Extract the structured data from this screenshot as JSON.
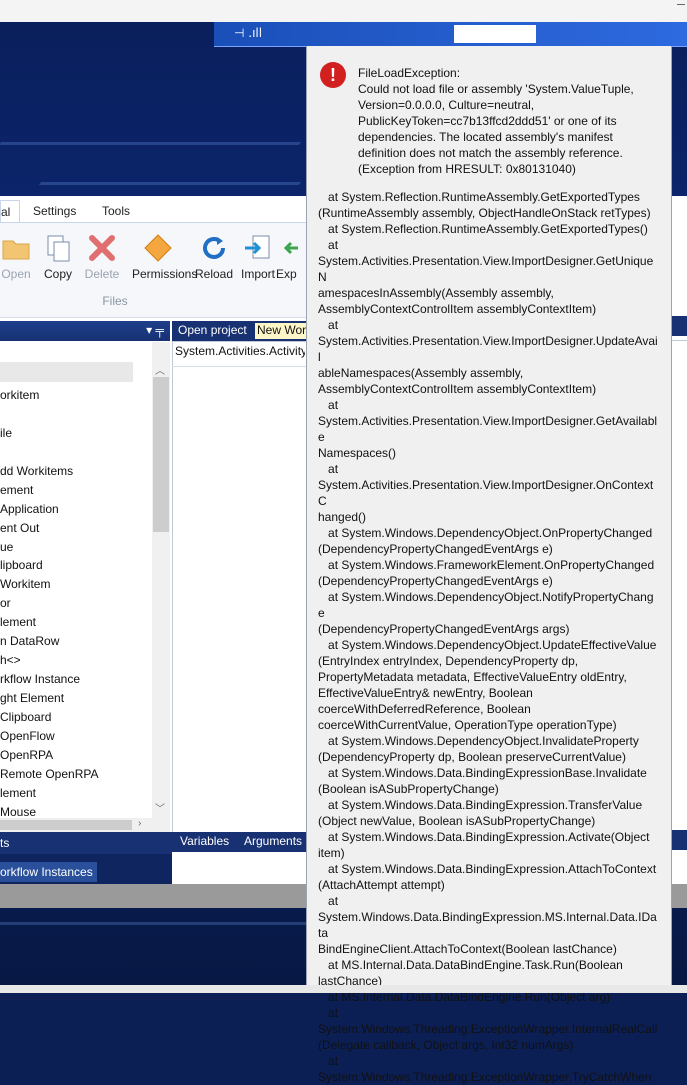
{
  "taskbar": {
    "tray_text": "⊣ .ıll"
  },
  "ribbon": {
    "tabs": [
      {
        "label": "al",
        "active": true
      },
      {
        "label": "Settings",
        "active": false
      },
      {
        "label": "Tools",
        "active": false
      }
    ],
    "buttons": [
      {
        "label": "Open",
        "icon": "folder-icon",
        "enabled": false
      },
      {
        "label": "Copy",
        "icon": "copy-icon",
        "enabled": true
      },
      {
        "label": "Delete",
        "icon": "delete-x-icon",
        "enabled": false
      },
      {
        "label": "Permissions",
        "icon": "key-icon",
        "enabled": true
      },
      {
        "label": "Reload",
        "icon": "reload-icon",
        "enabled": true
      },
      {
        "label": "Import",
        "icon": "import-icon",
        "enabled": true
      },
      {
        "label": "Exp",
        "icon": "export-icon",
        "enabled": true
      }
    ],
    "group_label": "Files"
  },
  "toolbox": {
    "pin": "▾ ╤",
    "items": [
      "orkitem",
      "ile",
      "dd Workitems",
      "ement",
      "Application",
      "ent Out",
      "ue",
      "lipboard",
      "Workitem",
      "or",
      "lement",
      "n DataRow",
      "h<>",
      "rkflow Instance",
      "ght Element",
      "Clipboard",
      "OpenFlow",
      "OpenRPA",
      "Remote OpenRPA",
      "lement",
      "Mouse"
    ],
    "footer": "ts",
    "workflow_instances": "orkflow Instances"
  },
  "designer": {
    "open_project": "Open project",
    "new_workflow": "New Wor",
    "activity": "System.Activities.Activity",
    "tabs": [
      "Variables",
      "Arguments"
    ]
  },
  "dialog": {
    "icon": "!",
    "message": "FileLoadException:\nCould not load file or assembly 'System.ValueTuple,\nVersion=0.0.0.0, Culture=neutral,\nPublicKeyToken=cc7b13ffcd2ddd51' or one of its\ndependencies. The located assembly's manifest\ndefinition does not match the assembly reference.\n(Exception from HRESULT: 0x80131040)",
    "stack_trace": "   at System.Reflection.RuntimeAssembly.GetExportedTypes\n(RuntimeAssembly assembly, ObjectHandleOnStack retTypes)\n   at System.Reflection.RuntimeAssembly.GetExportedTypes()\n   at\nSystem.Activities.Presentation.View.ImportDesigner.GetUniqueN\namespacesInAssembly(Assembly assembly,\nAssemblyContextControlItem assemblyContextItem)\n   at\nSystem.Activities.Presentation.View.ImportDesigner.UpdateAvail\nableNamespaces(Assembly assembly,\nAssemblyContextControlItem assemblyContextItem)\n   at\nSystem.Activities.Presentation.View.ImportDesigner.GetAvailable\nNamespaces()\n   at\nSystem.Activities.Presentation.View.ImportDesigner.OnContextC\nhanged()\n   at System.Windows.DependencyObject.OnPropertyChanged\n(DependencyPropertyChangedEventArgs e)\n   at System.Windows.FrameworkElement.OnPropertyChanged\n(DependencyPropertyChangedEventArgs e)\n   at System.Windows.DependencyObject.NotifyPropertyChange\n(DependencyPropertyChangedEventArgs args)\n   at System.Windows.DependencyObject.UpdateEffectiveValue\n(EntryIndex entryIndex, DependencyProperty dp,\nPropertyMetadata metadata, EffectiveValueEntry oldEntry,\nEffectiveValueEntry& newEntry, Boolean\ncoerceWithDeferredReference, Boolean\ncoerceWithCurrentValue, OperationType operationType)\n   at System.Windows.DependencyObject.InvalidateProperty\n(DependencyProperty dp, Boolean preserveCurrentValue)\n   at System.Windows.Data.BindingExpressionBase.Invalidate\n(Boolean isASubPropertyChange)\n   at System.Windows.Data.BindingExpression.TransferValue\n(Object newValue, Boolean isASubPropertyChange)\n   at System.Windows.Data.BindingExpression.Activate(Object\nitem)\n   at System.Windows.Data.BindingExpression.AttachToContext\n(AttachAttempt attempt)\n   at\nSystem.Windows.Data.BindingExpression.MS.Internal.Data.IData\nBindEngineClient.AttachToContext(Boolean lastChance)\n   at MS.Internal.Data.DataBindEngine.Task.Run(Boolean\nlastChance)\n   at MS.Internal.Data.DataBindEngine.Run(Object arg)\n   at\nSystem.Windows.Threading.ExceptionWrapper.InternalRealCall\n(Delegate callback, Object args, Int32 numArgs)\n   at\nSystem.Windows.Threading.ExceptionWrapper.TryCatchWhen"
  }
}
